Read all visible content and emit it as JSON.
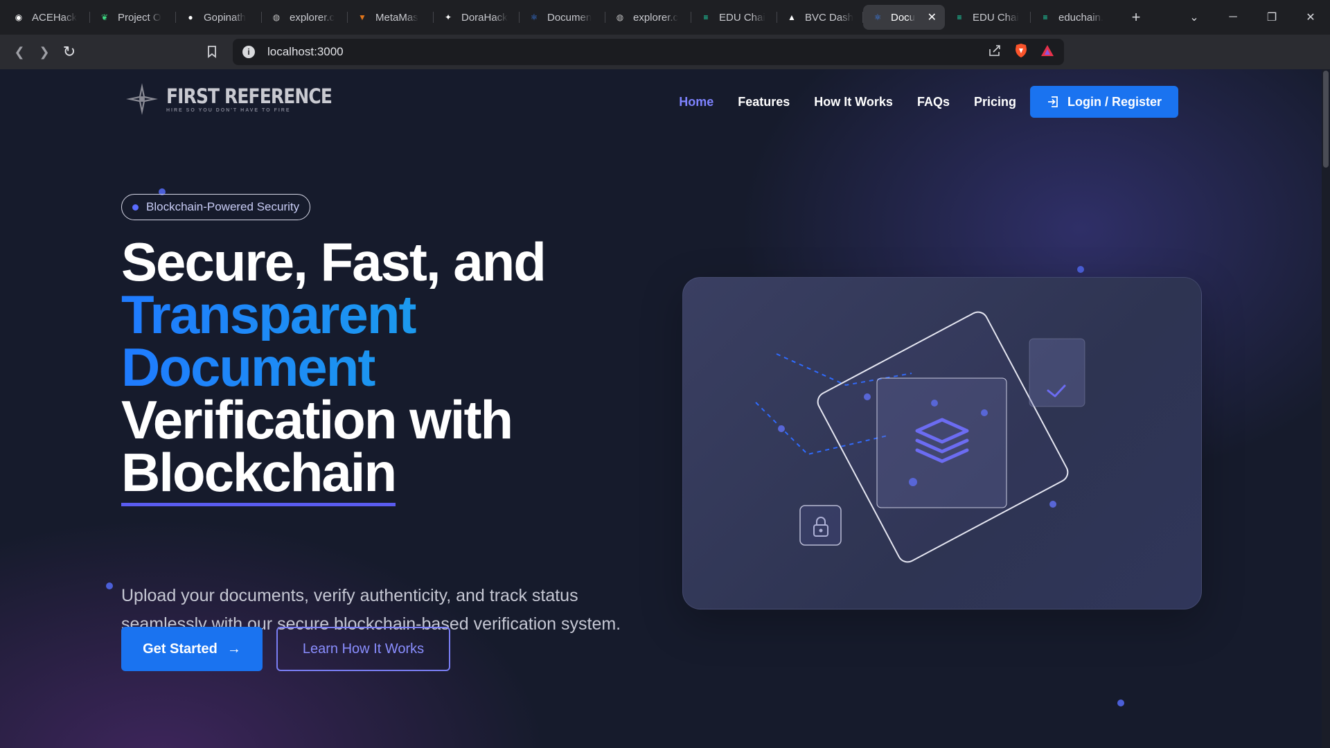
{
  "browser": {
    "tabs": [
      {
        "label": "ACEHack",
        "icon": "github-circle-icon",
        "color": "#ffffff"
      },
      {
        "label": "Project O",
        "icon": "leaf-icon",
        "color": "#3ddc84"
      },
      {
        "label": "Gopinath",
        "icon": "github-icon",
        "color": "#ffffff"
      },
      {
        "label": "explorer.c",
        "icon": "globe-icon",
        "color": "#c0c0c0"
      },
      {
        "label": "MetaMas",
        "icon": "metamask-icon",
        "color": "#e2761b"
      },
      {
        "label": "DoraHack",
        "icon": "dorahacks-icon",
        "color": "#ffffff"
      },
      {
        "label": "Documen",
        "icon": "react-icon",
        "color": "#3b82f6"
      },
      {
        "label": "explorer.c",
        "icon": "globe-icon",
        "color": "#c0c0c0"
      },
      {
        "label": "EDU Chai",
        "icon": "edu-icon",
        "color": "#1de9b6"
      },
      {
        "label": "BVC Dash",
        "icon": "triangle-icon",
        "color": "#ffffff"
      },
      {
        "label": "Docu",
        "icon": "react-icon",
        "color": "#3b82f6"
      },
      {
        "label": "EDU Chai",
        "icon": "edu-chain-icon",
        "color": "#1de9b6"
      },
      {
        "label": "educhain.",
        "icon": "edu-chain-icon",
        "color": "#1de9b6"
      }
    ],
    "active_tab_index": 10,
    "url": "localhost:3000"
  },
  "site": {
    "logo": {
      "title": "FIRST REFERENCE",
      "tagline": "HIRE SO YOU DON'T HAVE TO FIRE"
    },
    "nav": [
      "Home",
      "Features",
      "How It Works",
      "FAQs",
      "Pricing"
    ],
    "active_nav": "Home",
    "login_label": "Login / Register",
    "accent_color": "#1a73f0"
  },
  "hero": {
    "badge": "Blockchain-Powered Security",
    "title_line1": "Secure, Fast, and",
    "title_line2": "Transparent",
    "title_line3": "Document",
    "title_line4": "Verification with",
    "title_line5": "Blockchain",
    "subtitle": "Upload your documents, verify authenticity, and track status seamlessly with our secure blockchain-based verification system.",
    "primary_cta": "Get Started",
    "secondary_cta": "Learn How It Works"
  }
}
